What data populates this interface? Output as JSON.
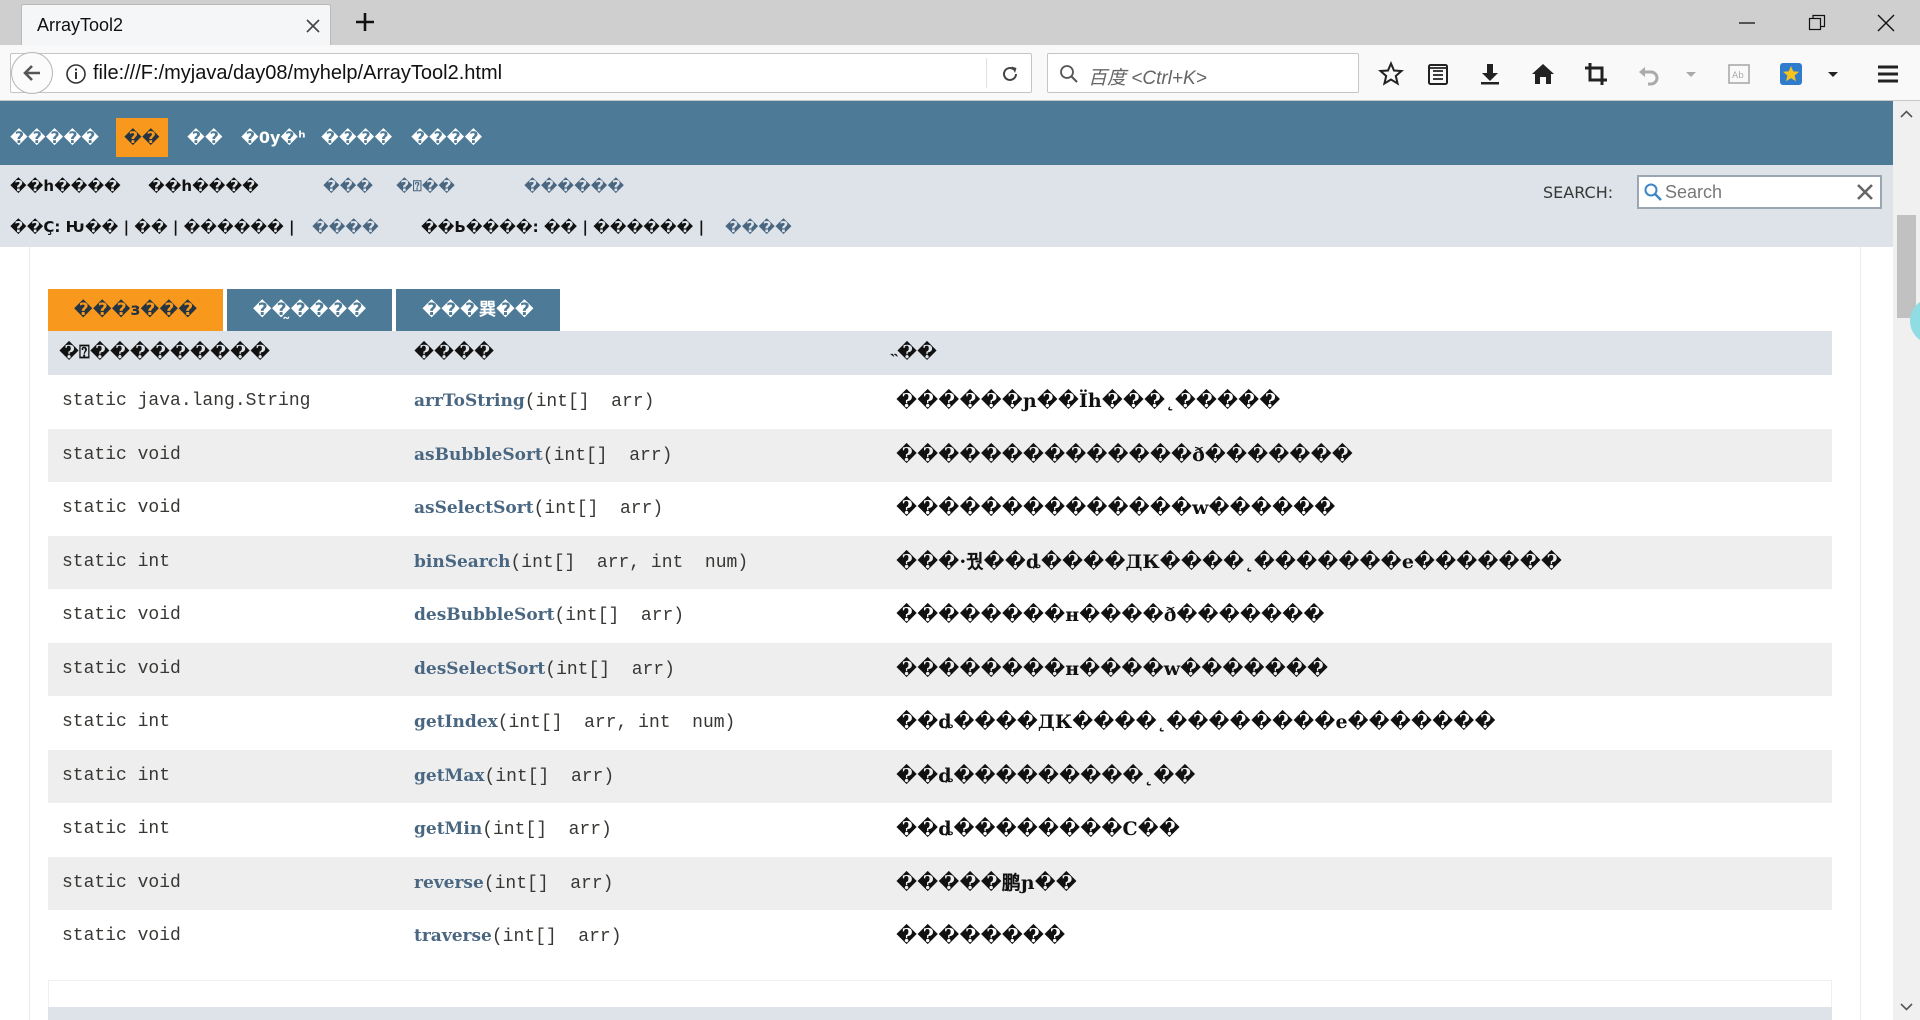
{
  "theme": {
    "nav_bg": "#4d7a97",
    "active_bg": "#f8981d",
    "subnav_bg": "#dee3e9",
    "link": "#4a6782"
  },
  "browser": {
    "tab_title": "ArrayTool2",
    "url": "file:///F:/myjava/day08/myhelp/ArrayTool2.html",
    "search_placeholder": "百度 <Ctrl+K>"
  },
  "topnav": {
    "items": [
      "�����",
      "��",
      "��",
      "�0y�ʰ",
      "����",
      "����"
    ]
  },
  "subnav": {
    "prev_class": "��h����",
    "next_class": "��h����",
    "frames": "���",
    "no_frames": "�⍰��",
    "all_classes": "������",
    "search_label": "SEARCH:",
    "search_placeholder": "Search",
    "summary_prefix": "��Ç: Ƕ�� | �� | ������ | ",
    "summary_method": "����",
    "detail_prefix": "��Ь����: �� | ������ | ",
    "detail_method": "����"
  },
  "tabs": [
    "���з���",
    "��̰����",
    "���巽��"
  ],
  "table": {
    "headers": [
      "�⍰���������",
      "����",
      "˵��"
    ],
    "rows": [
      {
        "modifier": "static java.lang.String",
        "method": "arrToString",
        "params": "(int[]  arr)",
        "description": "������ɲ��Ïh���˛�����"
      },
      {
        "modifier": "static void",
        "method": "asBubbleSort",
        "params": "(int[]  arr)",
        "description": "��������������ð�������"
      },
      {
        "modifier": "static void",
        "method": "asSelectSort",
        "params": "(int[]  arr)",
        "description": "��������������w������"
      },
      {
        "modifier": "static int",
        "method": "binSearch",
        "params": "(int[]  arr, int  num)",
        "description": "���·꿨��ȡ����ДК����˛�������e�������"
      },
      {
        "modifier": "static void",
        "method": "desBubbleSort",
        "params": "(int[]  arr)",
        "description": "��������н����ð�������"
      },
      {
        "modifier": "static void",
        "method": "desSelectSort",
        "params": "(int[]  arr)",
        "description": "��������н����w�������"
      },
      {
        "modifier": "static int",
        "method": "getIndex",
        "params": "(int[]  arr, int  num)",
        "description": "��ȡ����ДК����˛��������e�������"
      },
      {
        "modifier": "static int",
        "method": "getMax",
        "params": "(int[]  arr)",
        "description": "��ȡ���������˛��"
      },
      {
        "modifier": "static int",
        "method": "getMin",
        "params": "(int[]  arr)",
        "description": "��ȡ��������С��"
      },
      {
        "modifier": "static void",
        "method": "reverse",
        "params": "(int[]  arr)",
        "description": "�����鹏ɲ��"
      },
      {
        "modifier": "static void",
        "method": "traverse",
        "params": "(int[]  arr)",
        "description": "��������"
      }
    ]
  }
}
